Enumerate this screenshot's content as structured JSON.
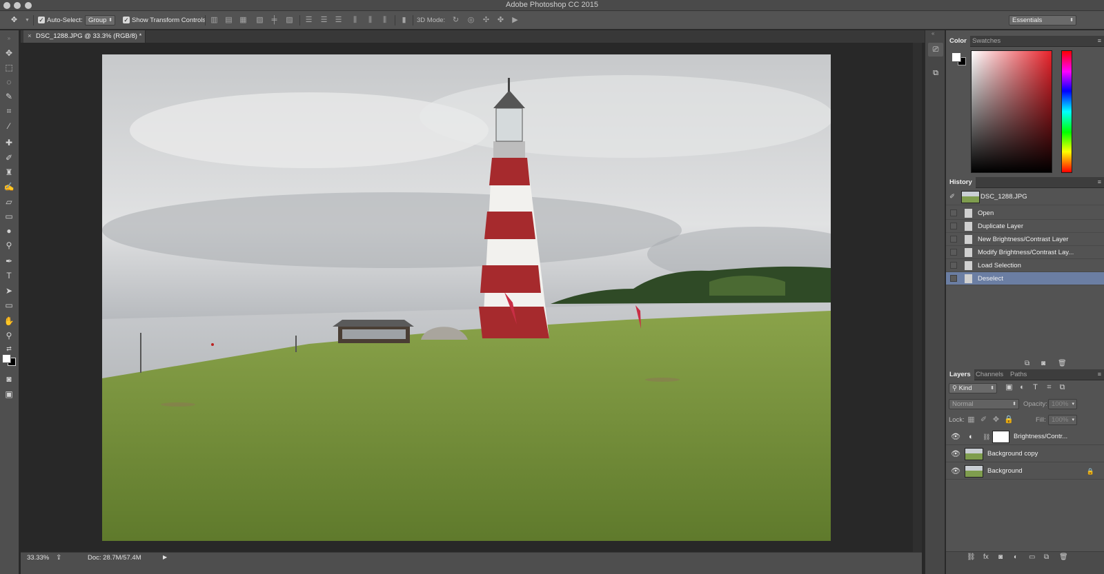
{
  "window": {
    "title": "Adobe Photoshop CC 2015"
  },
  "options_bar": {
    "auto_select_label": "Auto-Select:",
    "auto_select_value": "Group",
    "show_transform_label": "Show Transform Controls",
    "mode_3d_label": "3D Mode:",
    "workspace": "Essentials"
  },
  "document": {
    "tab_title": "DSC_1288.JPG @ 33.3% (RGB/8) *",
    "zoom": "33.33%",
    "doc_size": "Doc: 28.7M/57.4M"
  },
  "color_panel": {
    "tabs": [
      "Color",
      "Swatches"
    ],
    "accent_hue": "#e8222a"
  },
  "history_panel": {
    "title": "History",
    "snapshot": "DSC_1288.JPG",
    "steps": [
      "Open",
      "Duplicate Layer",
      "New Brightness/Contrast Layer",
      "Modify Brightness/Contrast Lay...",
      "Load Selection",
      "Deselect"
    ],
    "selected_step": "Deselect"
  },
  "layers_panel": {
    "tabs": [
      "Layers",
      "Channels",
      "Paths"
    ],
    "filter": "Kind",
    "blend_mode": "Normal",
    "opacity_label": "Opacity:",
    "opacity_value": "100%",
    "lock_label": "Lock:",
    "fill_label": "Fill:",
    "fill_value": "100%",
    "layers": [
      "Brightness/Contr...",
      "Background copy",
      "Background"
    ]
  },
  "colors": {
    "selection": "#6b7ea3",
    "ui_dark": "#535353"
  }
}
